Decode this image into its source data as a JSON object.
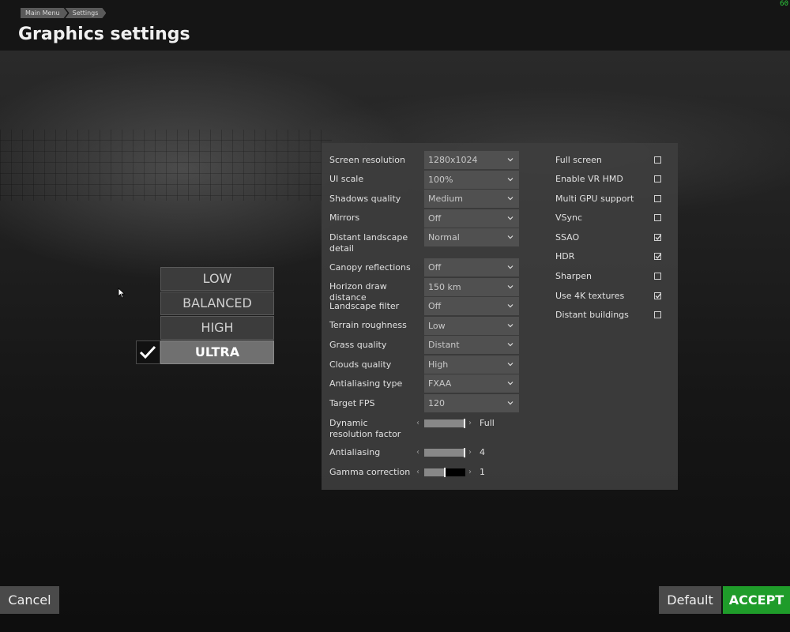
{
  "breadcrumb": [
    "Main Menu",
    "Settings"
  ],
  "title": "Graphics settings",
  "fps_counter": "60",
  "presets": {
    "items": [
      "LOW",
      "BALANCED",
      "HIGH",
      "ULTRA"
    ],
    "selected": "ULTRA",
    "check_icon": "check-icon"
  },
  "options": [
    {
      "label": "Screen resolution",
      "value": "1280x1024"
    },
    {
      "label": "UI scale",
      "value": "100%"
    },
    {
      "label": "Shadows quality",
      "value": "Medium"
    },
    {
      "label": "Mirrors",
      "value": "Off"
    },
    {
      "label": "Distant landscape detail",
      "value": "Normal"
    },
    {
      "label": "Canopy reflections",
      "value": "Off"
    },
    {
      "label": "Horizon draw distance",
      "value": "150 km"
    },
    {
      "label": "Landscape filter",
      "value": "Off"
    },
    {
      "label": "Terrain roughness",
      "value": "Low"
    },
    {
      "label": "Grass quality",
      "value": "Distant"
    },
    {
      "label": "Clouds quality",
      "value": "High"
    },
    {
      "label": "Antialiasing type",
      "value": "FXAA"
    },
    {
      "label": "Target FPS",
      "value": "120"
    }
  ],
  "sliders": [
    {
      "label": "Dynamic resolution factor",
      "value": "Full",
      "level": 1.0
    },
    {
      "label": "Antialiasing",
      "value": "4",
      "level": 1.0
    },
    {
      "label": "Gamma correction",
      "value": "1",
      "level": 0.5
    }
  ],
  "toggles": [
    {
      "label": "Full screen",
      "checked": false
    },
    {
      "label": "Enable VR HMD",
      "checked": false
    },
    {
      "label": "Multi GPU support",
      "checked": false
    },
    {
      "label": "VSync",
      "checked": false
    },
    {
      "label": "SSAO",
      "checked": true
    },
    {
      "label": "HDR",
      "checked": true
    },
    {
      "label": "Sharpen",
      "checked": false
    },
    {
      "label": "Use 4K textures",
      "checked": true
    },
    {
      "label": "Distant buildings",
      "checked": false
    }
  ],
  "buttons": {
    "cancel": "Cancel",
    "default": "Default",
    "accept": "ACCEPT"
  },
  "colors": {
    "accent": "#1f9c2a",
    "fps": "#2ed13c"
  }
}
